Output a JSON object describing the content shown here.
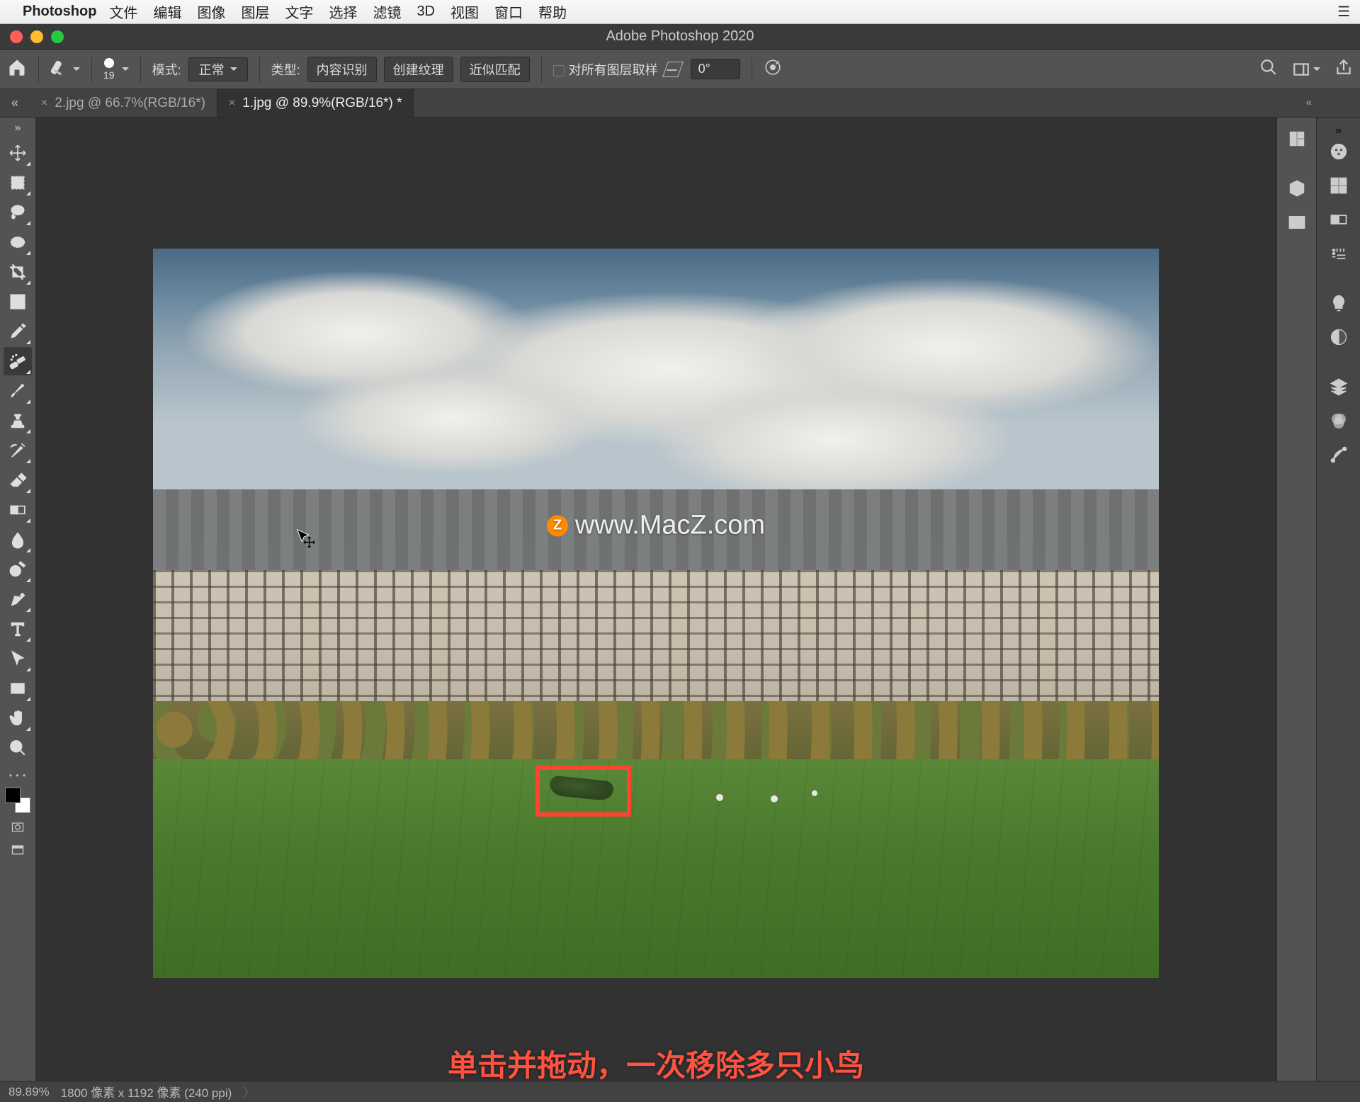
{
  "menubar": {
    "app": "Photoshop",
    "items": [
      "文件",
      "编辑",
      "图像",
      "图层",
      "文字",
      "选择",
      "滤镜",
      "3D",
      "视图",
      "窗口",
      "帮助"
    ]
  },
  "window": {
    "title": "Adobe Photoshop 2020"
  },
  "options": {
    "brush_size": "19",
    "mode_label": "模式:",
    "mode_value": "正常",
    "type_label": "类型:",
    "type_buttons": [
      "内容识别",
      "创建纹理",
      "近似匹配"
    ],
    "sample_all": "对所有图层取样",
    "angle_value": "0°"
  },
  "tabs": [
    {
      "label": "2.jpg @ 66.7%(RGB/16*)",
      "active": false
    },
    {
      "label": "1.jpg @ 89.9%(RGB/16*) *",
      "active": true
    }
  ],
  "watermark": "www.MacZ.com",
  "instruction": "单击并拖动，一次移除多只小鸟",
  "status": {
    "zoom": "89.89%",
    "dims": "1800 像素 x 1192 像素 (240 ppi)"
  },
  "tools": [
    "move",
    "marquee",
    "lasso",
    "magic-wand",
    "crop",
    "frame",
    "eyedropper",
    "healing-brush",
    "brush",
    "clone-stamp",
    "history-brush",
    "eraser",
    "gradient",
    "blur",
    "dodge",
    "pen",
    "type",
    "path-select",
    "rectangle",
    "hand",
    "zoom"
  ],
  "right_panel_1": [
    "history",
    "3d",
    "properties"
  ],
  "right_panel_2": [
    "color",
    "swatches",
    "gradients",
    "patterns",
    "brushes",
    "adjustments",
    "layers",
    "channels",
    "paths"
  ]
}
